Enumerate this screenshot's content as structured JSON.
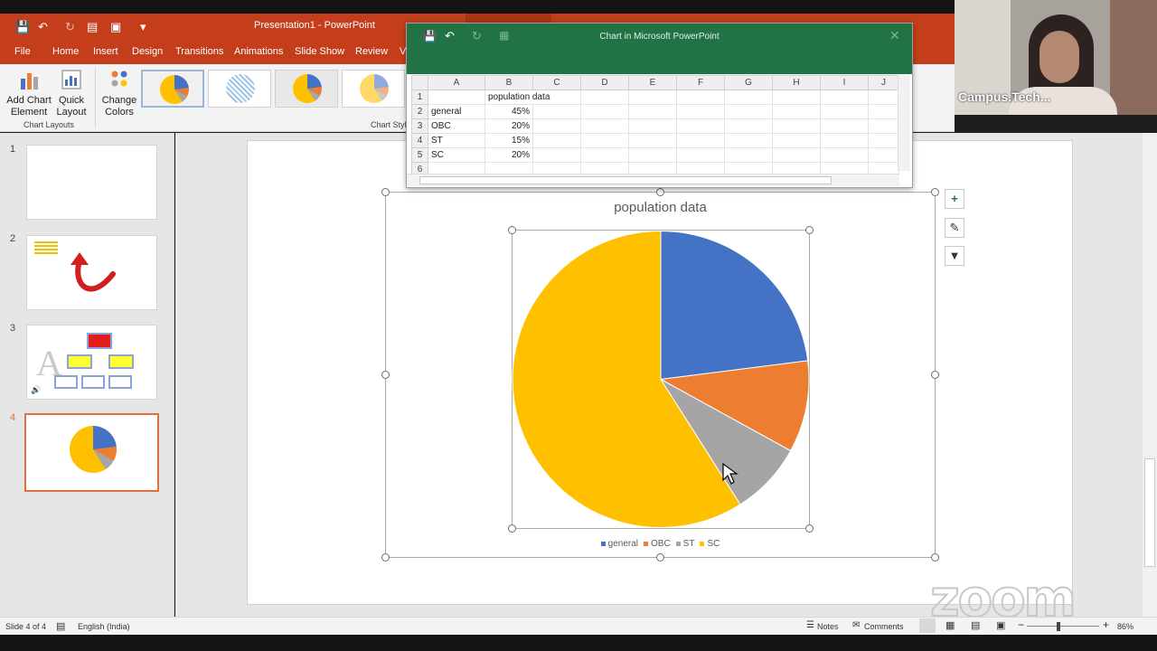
{
  "app": {
    "title": "Presentation1  -  PowerPoint",
    "menu": [
      "File",
      "Home",
      "Insert",
      "Design",
      "Transitions",
      "Animations",
      "Slide Show",
      "Review",
      "V"
    ],
    "ribbon": {
      "add_chart_element": "Add Chart Element",
      "quick_layout": "Quick Layout",
      "change_colors": "Change Colors",
      "chart_layouts_label": "Chart Layouts",
      "chart_styles_label": "Chart Styl"
    }
  },
  "slides": [
    "1",
    "2",
    "3",
    "4"
  ],
  "spreadsheet": {
    "title": "Chart in Microsoft PowerPoint",
    "columns": [
      "A",
      "B",
      "C",
      "D",
      "E",
      "F",
      "G",
      "H",
      "I",
      "J"
    ],
    "rows": [
      {
        "num": "1",
        "a": "",
        "b": "population data"
      },
      {
        "num": "2",
        "a": "general",
        "b": "45%"
      },
      {
        "num": "3",
        "a": "OBC",
        "b": "20%"
      },
      {
        "num": "4",
        "a": "ST",
        "b": "15%"
      },
      {
        "num": "5",
        "a": "SC",
        "b": "20%"
      },
      {
        "num": "6",
        "a": "",
        "b": ""
      }
    ]
  },
  "chart_data": {
    "type": "pie",
    "title": "population data",
    "categories": [
      "general",
      "OBC",
      "ST",
      "SC"
    ],
    "values": [
      23,
      10,
      8,
      59
    ],
    "colors": [
      "#4472c4",
      "#ed7d31",
      "#a5a5a5",
      "#ffc000"
    ],
    "legend_position": "bottom"
  },
  "webcam": {
    "name": "Campus.Tech..."
  },
  "zoom_watermark": "zoom",
  "status": {
    "slide": "Slide 4 of 4",
    "language": "English (India)",
    "notes": "Notes",
    "comments": "Comments",
    "zoom_level": "86%"
  }
}
